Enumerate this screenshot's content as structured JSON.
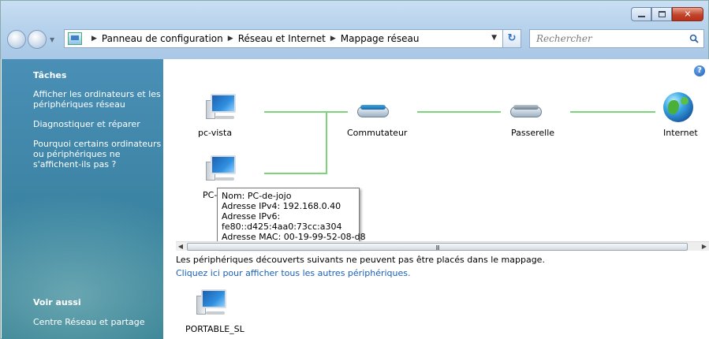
{
  "breadcrumbs": [
    "Panneau de configuration",
    "Réseau et Internet",
    "Mappage réseau"
  ],
  "search": {
    "placeholder": "Rechercher"
  },
  "sidebar": {
    "tasks_heading": "Tâches",
    "tasks": [
      [
        "Afficher les ordinateurs et les",
        "périphériques réseau"
      ],
      [
        "Diagnostiquer et réparer"
      ],
      [
        "Pourquoi certains ordinateurs",
        "ou périphériques ne",
        "s'affichent-ils pas ?"
      ]
    ],
    "see_also_heading": "Voir aussi",
    "see_also": [
      "Centre Réseau et partage"
    ]
  },
  "map": {
    "devices": {
      "pc_vista": "pc-vista",
      "switch": "Commutateur",
      "gateway": "Passerelle",
      "internet": "Internet",
      "pc_jojo": "PC-",
      "portable": "PORTABLE_SL"
    }
  },
  "tooltip": {
    "lines": [
      "Nom: PC-de-jojo",
      "Adresse IPv4: 192.168.0.40",
      "Adresse IPv6:",
      "fe80::d425:4aa0:73cc:a304",
      "Adresse MAC: 00-19-99-52-08-d8"
    ]
  },
  "scrollbar": {
    "grip": "III"
  },
  "undiscovered_text": "Les périphériques découverts suivants ne peuvent pas être placés dans le mappage.",
  "show_all_link": "Cliquez ici pour afficher tous les autres périphériques.",
  "colors": {
    "link": "#1a5fb5",
    "connection": "#7bd37a",
    "task_pane": "#3f86a8"
  }
}
